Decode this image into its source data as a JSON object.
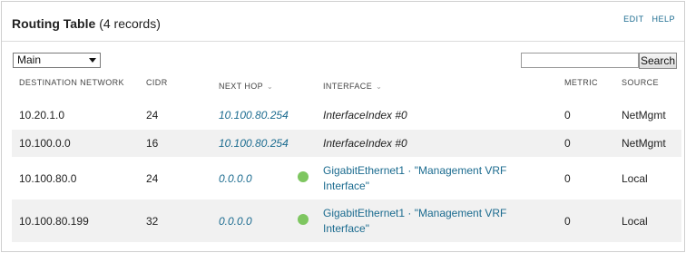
{
  "header": {
    "title": "Routing Table",
    "record_count": "(4 records)",
    "links": [
      "EDIT",
      "HELP"
    ]
  },
  "toolbar": {
    "vrf_select_value": "Main",
    "search_value": "",
    "search_button": "Search"
  },
  "table": {
    "columns": {
      "destination": "DESTINATION NETWORK",
      "cidr": "CIDR",
      "next_hop": "NEXT HOP",
      "interface": "INTERFACE",
      "metric": "METRIC",
      "source": "SOURCE"
    },
    "sort_indicator": "⌄",
    "rows": [
      {
        "destination": "10.20.1.0",
        "cidr": "24",
        "next_hop": "10.100.80.254",
        "interface": "InterfaceIndex #0",
        "interface_link": false,
        "status": "none",
        "metric": "0",
        "source": "NetMgmt"
      },
      {
        "destination": "10.100.0.0",
        "cidr": "16",
        "next_hop": "10.100.80.254",
        "interface": "InterfaceIndex #0",
        "interface_link": false,
        "status": "none",
        "metric": "0",
        "source": "NetMgmt"
      },
      {
        "destination": "10.100.80.0",
        "cidr": "24",
        "next_hop": "0.0.0.0",
        "interface": "GigabitEthernet1 · \"Management VRF Interface\"",
        "interface_link": true,
        "status": "up",
        "metric": "0",
        "source": "Local"
      },
      {
        "destination": "10.100.80.199",
        "cidr": "32",
        "next_hop": "0.0.0.0",
        "interface": "GigabitEthernet1 · \"Management VRF Interface\"",
        "interface_link": true,
        "status": "up",
        "metric": "0",
        "source": "Local"
      }
    ]
  },
  "colors": {
    "link": "#1b6b8f",
    "status_up": "#7ec660",
    "row_alt": "#f1f1f1"
  }
}
